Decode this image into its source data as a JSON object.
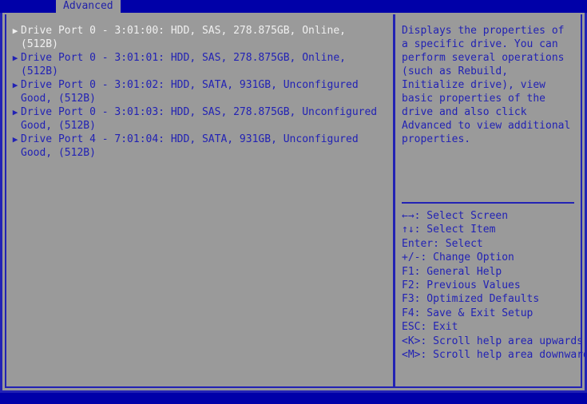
{
  "colors": {
    "background_blue": "#0000a8",
    "panel_gray": "#9a9a9a",
    "text_blue": "#2222b4",
    "selected_text": "#f0f0f0",
    "border_blue": "#2222b4"
  },
  "tabs": [
    {
      "label": "Advanced",
      "active": true
    }
  ],
  "main": {
    "drives": [
      {
        "bullet": "▶",
        "text": "Drive Port 0 - 3:01:00: HDD, SAS, 278.875GB, Online, (512B)",
        "selected": true
      },
      {
        "bullet": "▶",
        "text": "Drive Port 0 - 3:01:01: HDD, SAS, 278.875GB, Online, (512B)",
        "selected": false
      },
      {
        "bullet": "▶",
        "text": "Drive Port 0 - 3:01:02: HDD, SATA, 931GB, Unconfigured Good, (512B)",
        "selected": false
      },
      {
        "bullet": "▶",
        "text": "Drive Port 0 - 3:01:03: HDD, SAS, 278.875GB, Unconfigured Good, (512B)",
        "selected": false
      },
      {
        "bullet": "▶",
        "text": "Drive Port 4 - 7:01:04: HDD, SATA, 931GB, Unconfigured Good, (512B)",
        "selected": false
      }
    ]
  },
  "help": {
    "description": "Displays the properties of a specific drive. You can perform several operations (such as Rebuild, Initialize drive), view basic properties of the drive and also click Advanced to view additional properties.",
    "legend": [
      {
        "key": "←→",
        "label": ": Select Screen"
      },
      {
        "key": "↑↓",
        "label": ": Select Item"
      },
      {
        "key": "Enter",
        "label": ": Select"
      },
      {
        "key": "+/-",
        "label": ": Change Option"
      },
      {
        "key": "F1",
        "label": ": General Help"
      },
      {
        "key": "F2",
        "label": ": Previous Values"
      },
      {
        "key": "F3",
        "label": ": Optimized Defaults"
      },
      {
        "key": "F4",
        "label": ": Save & Exit Setup"
      },
      {
        "key": "ESC",
        "label": ": Exit"
      },
      {
        "key": "<K>",
        "label": ": Scroll help area upwards"
      },
      {
        "key": "<M>",
        "label": ": Scroll help area downwards"
      }
    ]
  }
}
